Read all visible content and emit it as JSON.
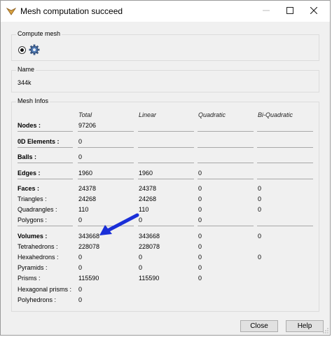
{
  "window": {
    "title": "Mesh computation succeed"
  },
  "compute": {
    "title": "Compute mesh"
  },
  "name": {
    "title": "Name",
    "value": "344k"
  },
  "mesh": {
    "title": "Mesh Infos",
    "headers": [
      "Total",
      "Linear",
      "Quadratic",
      "Bi-Quadratic"
    ],
    "rows": [
      {
        "label": "Nodes :",
        "bold": true,
        "values": [
          "97206",
          "",
          "",
          ""
        ]
      },
      {
        "label": "0D Elements :",
        "bold": true,
        "values": [
          "0",
          "",
          "",
          ""
        ]
      },
      {
        "label": "Balls :",
        "bold": true,
        "values": [
          "0",
          "",
          "",
          ""
        ]
      },
      {
        "label": "Edges :",
        "bold": true,
        "values": [
          "1960",
          "1960",
          "0",
          ""
        ]
      },
      {
        "label": "Faces :",
        "bold": true,
        "values": [
          "24378",
          "24378",
          "0",
          "0"
        ]
      },
      {
        "label": "Triangles :",
        "bold": false,
        "values": [
          "24268",
          "24268",
          "0",
          "0"
        ]
      },
      {
        "label": "Quadrangles :",
        "bold": false,
        "values": [
          "110",
          "110",
          "0",
          "0"
        ]
      },
      {
        "label": "Polygons :",
        "bold": false,
        "values": [
          "0",
          "0",
          "0",
          ""
        ]
      },
      {
        "label": "Volumes :",
        "bold": true,
        "values": [
          "343668",
          "343668",
          "0",
          "0"
        ]
      },
      {
        "label": "Tetrahedrons :",
        "bold": false,
        "values": [
          "228078",
          "228078",
          "0",
          ""
        ]
      },
      {
        "label": "Hexahedrons :",
        "bold": false,
        "values": [
          "0",
          "0",
          "0",
          "0"
        ]
      },
      {
        "label": "Pyramids :",
        "bold": false,
        "values": [
          "0",
          "0",
          "0",
          ""
        ]
      },
      {
        "label": "Prisms :",
        "bold": false,
        "values": [
          "115590",
          "115590",
          "0",
          ""
        ]
      },
      {
        "label": "Hexagonal prisms :",
        "bold": false,
        "values": [
          "0",
          "",
          "",
          ""
        ]
      },
      {
        "label": "Polyhedrons :",
        "bold": false,
        "values": [
          "0",
          "",
          "",
          ""
        ]
      }
    ]
  },
  "buttons": {
    "close": "Close",
    "help": "Help"
  },
  "icons": [
    "app-icon",
    "minimize-icon",
    "maximize-icon",
    "close-icon",
    "gear-icon",
    "arrow-icon",
    "resize-grip-icon"
  ],
  "colors": {
    "arrow": "#1a2fd8",
    "window_bg": "#f0f0f0"
  }
}
